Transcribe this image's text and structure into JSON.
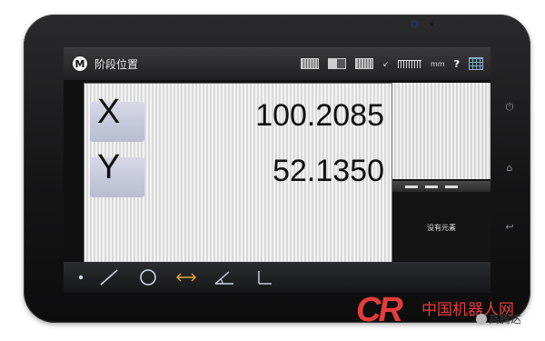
{
  "screen": {
    "title": "阶段位置",
    "logo_letter": "M",
    "unit": "mm",
    "help": "?"
  },
  "dro": {
    "x": {
      "label": "X",
      "value": "100.2085"
    },
    "y": {
      "label": "Y",
      "value": "52.1350"
    }
  },
  "feature_panel": {
    "empty_text": "没有元素"
  },
  "toolbar": {
    "tools": [
      "point-tool",
      "line-tool",
      "circle-tool",
      "distance-tool",
      "angle-tool",
      "origin-tool"
    ]
  },
  "watermark": {
    "cr": "CR",
    "site": "中国机器人网",
    "source": "高腾达"
  },
  "colors": {
    "accent": "#e43c3c",
    "toolbar_icon": "#cfd6e6",
    "distance_icon": "#e0a83a"
  }
}
